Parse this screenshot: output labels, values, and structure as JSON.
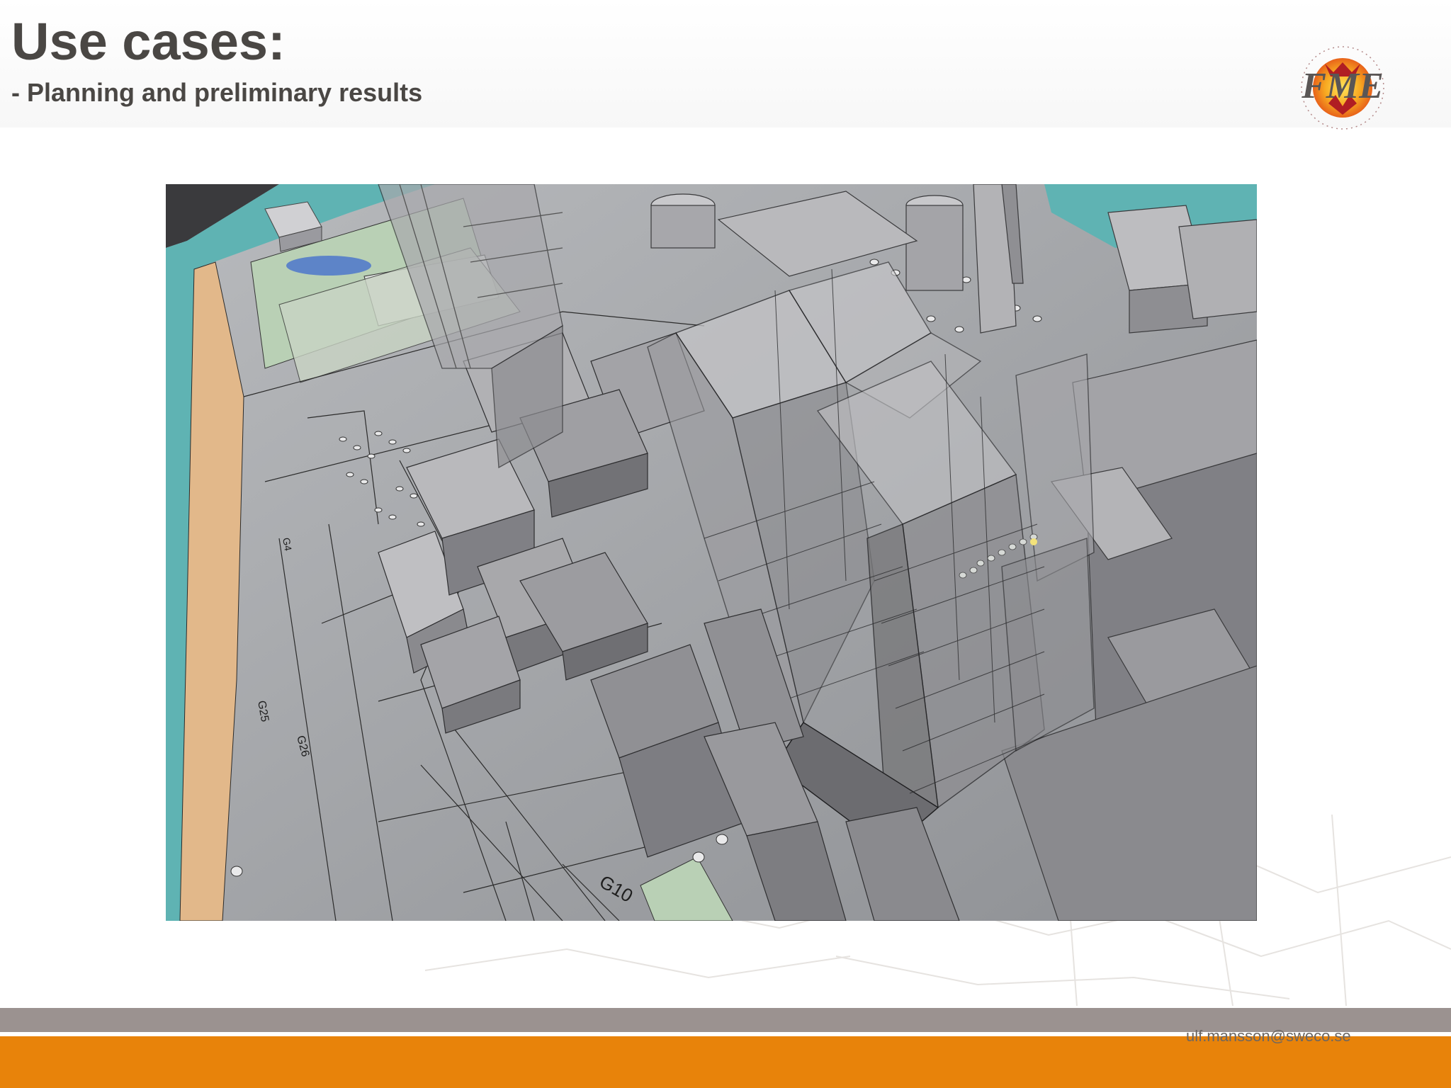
{
  "slide": {
    "title": "Use cases:",
    "subtitle": "- Planning and preliminary results",
    "email": "ulf.mansson@sweco.se"
  },
  "logo": {
    "text": "FME",
    "icon": "fme-logo-icon"
  },
  "figure": {
    "description_icon": "3d-city-model-image",
    "map_labels": {
      "g10": "G10",
      "g25": "G25",
      "g26": "G26",
      "g4": "G4"
    }
  },
  "colors": {
    "title": "#4a4744",
    "gray_band": "#9b9290",
    "orange_band": "#e8830a",
    "water": "#5fb3b3",
    "shore": "#e2b88a",
    "ground": "#a9abaf",
    "building": "#8c8c90"
  }
}
